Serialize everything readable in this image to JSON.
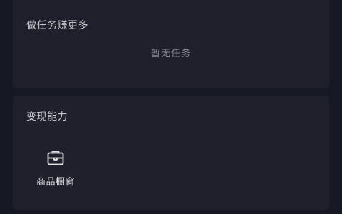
{
  "tasks_section": {
    "title": "做任务赚更多",
    "empty_text": "暂无任务"
  },
  "abilities_section": {
    "title": "变现能力",
    "items": [
      {
        "label": "商品橱窗",
        "icon": "shop-window-icon"
      }
    ]
  },
  "colors": {
    "background": "#161823",
    "card": "#1f202b",
    "title_text": "#c9cad0",
    "muted_text": "#8a8b94",
    "label_text": "#e6e6ea"
  }
}
